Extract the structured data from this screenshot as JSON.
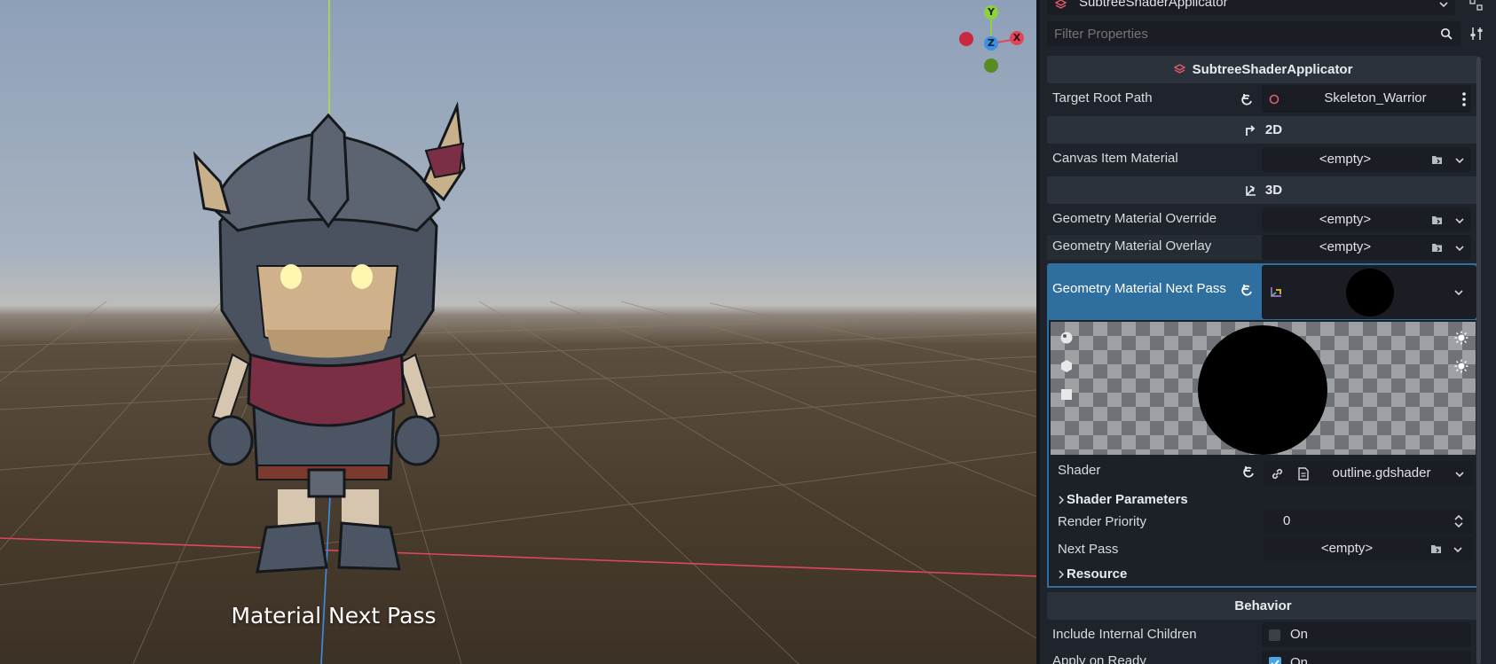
{
  "viewport": {
    "caption": "Material Next Pass",
    "gizmo": {
      "y": "Y",
      "x": "X",
      "z": "Z"
    }
  },
  "inspector": {
    "node_selector": {
      "value": "SubtreeShaderApplicator"
    },
    "filter": {
      "placeholder": "Filter Properties"
    },
    "class_header": "SubtreeShaderApplicator",
    "target_root_path": {
      "label": "Target Root Path",
      "value": "Skeleton_Warrior"
    },
    "section_2d": {
      "title": "2D"
    },
    "canvas_item_material": {
      "label": "Canvas Item Material",
      "value": "<empty>"
    },
    "section_3d": {
      "title": "3D"
    },
    "geometry_material_override": {
      "label": "Geometry Material Override",
      "value": "<empty>"
    },
    "geometry_material_overlay": {
      "label": "Geometry Material Overlay",
      "value": "<empty>"
    },
    "geometry_material_next_pass": {
      "label": "Geometry Material Next Pass"
    },
    "material_editor": {
      "shader": {
        "label": "Shader",
        "value": "outline.gdshader"
      },
      "shader_parameters": {
        "label": "Shader Parameters"
      },
      "render_priority": {
        "label": "Render Priority",
        "value": "0"
      },
      "next_pass": {
        "label": "Next Pass",
        "value": "<empty>"
      },
      "resource": {
        "label": "Resource"
      }
    },
    "section_behavior": {
      "title": "Behavior"
    },
    "include_internal_children": {
      "label": "Include Internal Children",
      "value": "On",
      "checked": false
    },
    "apply_on_ready": {
      "label": "Apply on Ready",
      "value": "On",
      "checked": true
    }
  },
  "colors": {
    "accent": "#4aa6e0",
    "selected_row": "#2f6fa0",
    "panel": "#1f242c",
    "field": "#1a1e24",
    "axis_x": "#e0465a",
    "axis_y": "#8fd03f",
    "axis_z": "#3c8fe3"
  }
}
